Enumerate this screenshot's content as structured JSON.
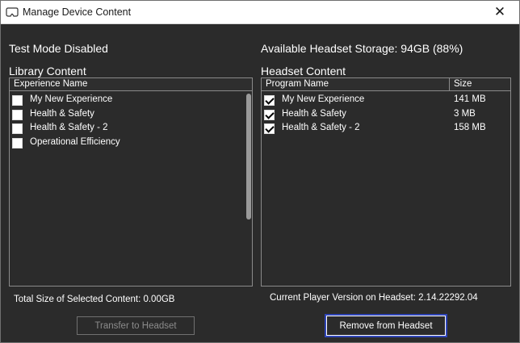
{
  "window": {
    "title": "Manage Device Content",
    "close_glyph": "✕",
    "app_icon": "vr-headset-icon"
  },
  "status": {
    "test_mode": "Test Mode Disabled",
    "storage": "Available Headset Storage: 94GB (88%)"
  },
  "library": {
    "title": "Library Content",
    "column_header": "Experience Name",
    "items": [
      {
        "label": "My New Experience",
        "checked": false
      },
      {
        "label": "Health & Safety",
        "checked": false
      },
      {
        "label": "Health & Safety - 2",
        "checked": false
      },
      {
        "label": "Operational Efficiency",
        "checked": false
      }
    ],
    "total_size": "Total Size of Selected Content: 0.00GB",
    "transfer_button": "Transfer to Headset"
  },
  "headset": {
    "title": "Headset Content",
    "columns": [
      "Program Name",
      "Size"
    ],
    "items": [
      {
        "label": "My New Experience",
        "size": "141 MB",
        "checked": true
      },
      {
        "label": "Health & Safety",
        "size": "3 MB",
        "checked": true
      },
      {
        "label": "Health & Safety - 2",
        "size": "158 MB",
        "checked": true
      }
    ],
    "player_version": "Current Player Version on Headset: 2.14.22292.04",
    "remove_button": "Remove from Headset"
  },
  "colors": {
    "background": "#2b2b2b",
    "titlebar": "#ffffff",
    "focus_border": "#2f45b8"
  }
}
